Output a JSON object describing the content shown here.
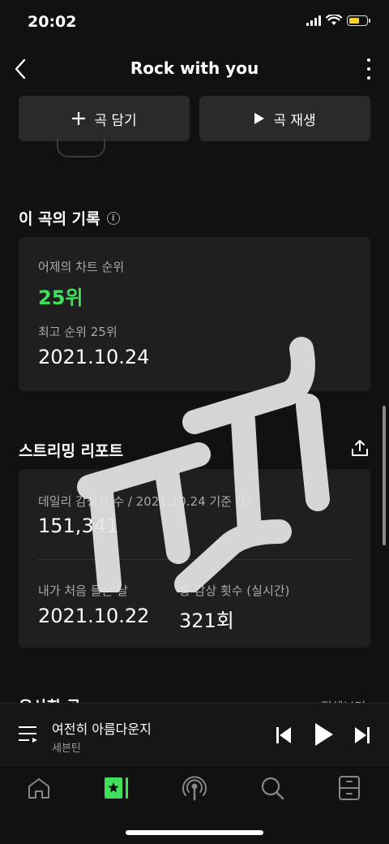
{
  "status": {
    "time": "20:02"
  },
  "header": {
    "title": "Rock with you"
  },
  "actions": {
    "add_label": "곡 담기",
    "play_label": "곡 재생"
  },
  "record": {
    "title": "이 곡의 기록",
    "chart_label": "어제의 차트 순위",
    "chart_rank": "25위",
    "best_label": "최고 순위 25위",
    "best_date": "2021.10.24"
  },
  "streaming": {
    "title": "스트리밍 리포트",
    "daily_label": "데일리 감상자 수 / 2021.10.24 기준",
    "daily_value": "151,341",
    "first_label": "내가 처음 들은 날",
    "first_value": "2021.10.22",
    "total_label": "총 감상 횟수 (실시간)",
    "total_value": "321회"
  },
  "similar": {
    "title": "유사한 곡",
    "more_label": "전체보기"
  },
  "player": {
    "song": "여전히 아름다운지",
    "artist": "세븐틴"
  },
  "colors": {
    "accent": "#3fe05a",
    "background": "#111111",
    "card": "#1f1f1f"
  },
  "icons": {
    "tabs": [
      "home-icon",
      "library-icon",
      "podcast-icon",
      "search-icon",
      "storage-icon"
    ]
  }
}
